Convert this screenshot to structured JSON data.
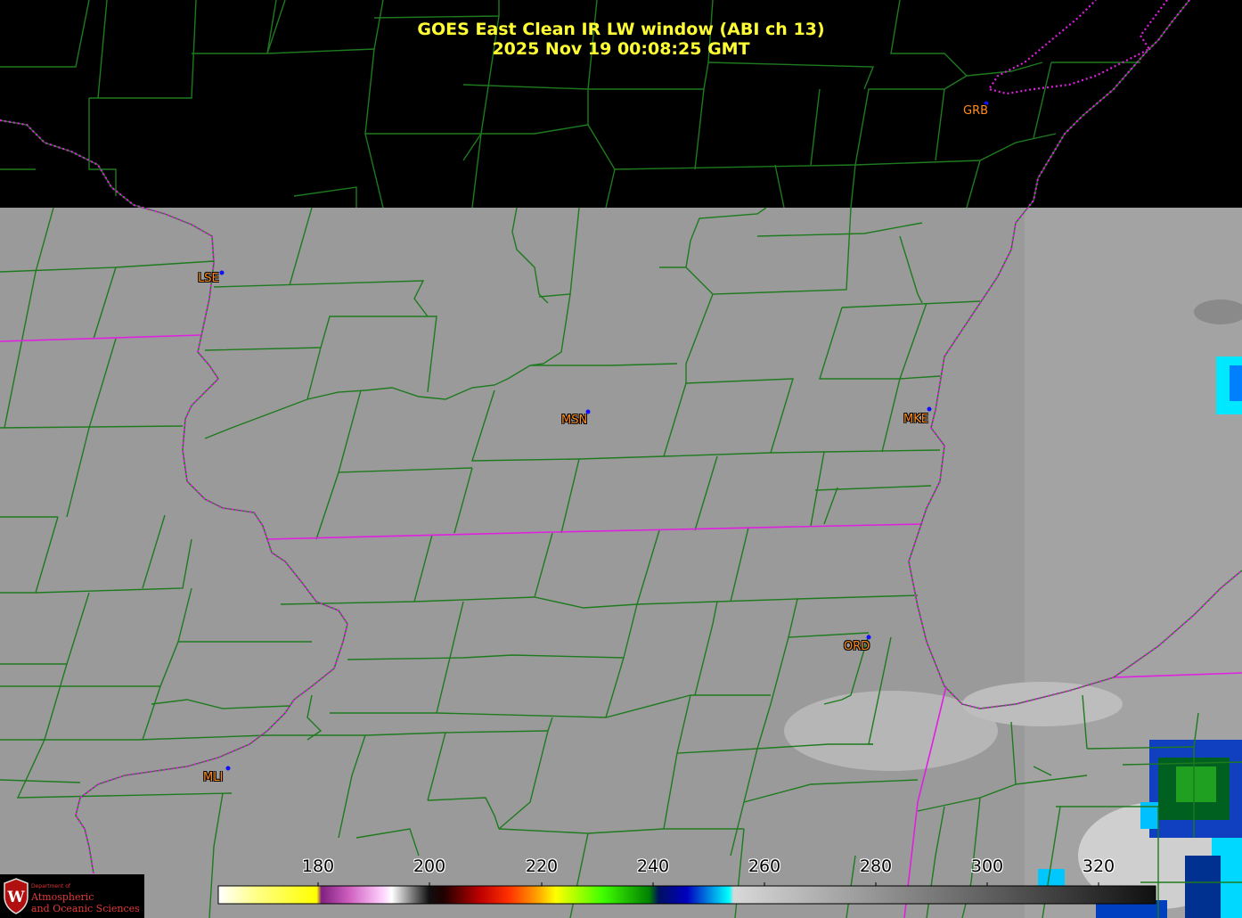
{
  "title": {
    "line1": "GOES East Clean IR LW window (ABI ch 13)",
    "line2": "2025 Nov 19  00:08:25 GMT"
  },
  "stations": [
    {
      "code": "GRB"
    },
    {
      "code": "LSE"
    },
    {
      "code": "MSN"
    },
    {
      "code": "MKE"
    },
    {
      "code": "ORD"
    },
    {
      "code": "MLI"
    }
  ],
  "colorbar": {
    "tick_labels": [
      "180",
      "200",
      "220",
      "240",
      "260",
      "280",
      "300",
      "320"
    ]
  },
  "logo": {
    "small_text": "Department of",
    "line1": "Atmospheric",
    "line2": "and Oceanic Sciences",
    "seal_letter": "W"
  },
  "colors": {
    "county_lines": "#1e7a1e",
    "state_lines": "#e020e0",
    "station_dot": "#1010ff",
    "station_label": "#ff8c1a",
    "title": "#ffff33"
  }
}
